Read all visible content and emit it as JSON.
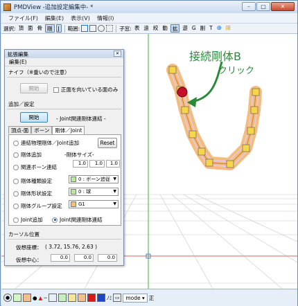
{
  "window": {
    "title": "PMDView -追加設定編集中- *",
    "minimize": "–",
    "maximize": "□",
    "close": "✕"
  },
  "menu": [
    "ファイル(F)",
    "編集(E)",
    "表示(V)",
    "情報(I)"
  ],
  "toolbar": {
    "select_label": "選択:",
    "select_items": [
      "頂",
      "面",
      "骨",
      "剛",
      "J"
    ],
    "range_label": "範囲:",
    "child_label": "子窓:",
    "child_items": [
      "表",
      "遠",
      "絞",
      "動",
      "拡",
      "遊",
      "G",
      "副",
      "T"
    ]
  },
  "viewport": {
    "annotation_title": "接続剛体B",
    "annotation_sub": "クリック",
    "accent_color": "#2a8a3a"
  },
  "panel": {
    "title": "拡張編集",
    "close_glyph": "✕",
    "menu": "編集(E)",
    "knife": {
      "heading": "ナイフ（※重いので注意）",
      "start_button": "開始",
      "front_only_label": "正面を向いている面のみ"
    },
    "add_settings": {
      "heading": "追加／設定",
      "start_button": "開始",
      "mode_label": "- Joint関連剛体連結 -"
    },
    "tabs": [
      "頂点-面",
      "ボーン",
      "剛体／Joint"
    ],
    "rigid": {
      "continuous_label": "連結物理剛体／Joint追加",
      "reset_button": "Reset",
      "add_rigid_label": "剛体追加",
      "size_label": "-剛体サイズ-",
      "related_bone_label": "関連ボーン連結",
      "size_values": [
        "1.0",
        "1.0",
        "1.0"
      ],
      "type_label": "剛体種類設定",
      "type_value": "0 : ボーン追従",
      "shape_label": "剛体形状設定",
      "shape_value": "0 : 球",
      "group_label": "剛体グループ設定",
      "group_value": "G1",
      "joint_add_label": "Joint追加",
      "joint_related_label": "Joint関連剛体連結"
    },
    "cursor": {
      "heading": "カーソル位置",
      "virtual_coord_label": "仮想座標：",
      "virtual_coord_value": "( 3.72, 15.76, 2.63 )",
      "virtual_center_label": "仮想中心：",
      "center_values": [
        "0.0",
        "0.0",
        "0.0"
      ]
    }
  },
  "statusbar": {
    "mode_label": "mode",
    "correct_label": "正",
    "aki_label": "ﾉﾐ"
  }
}
